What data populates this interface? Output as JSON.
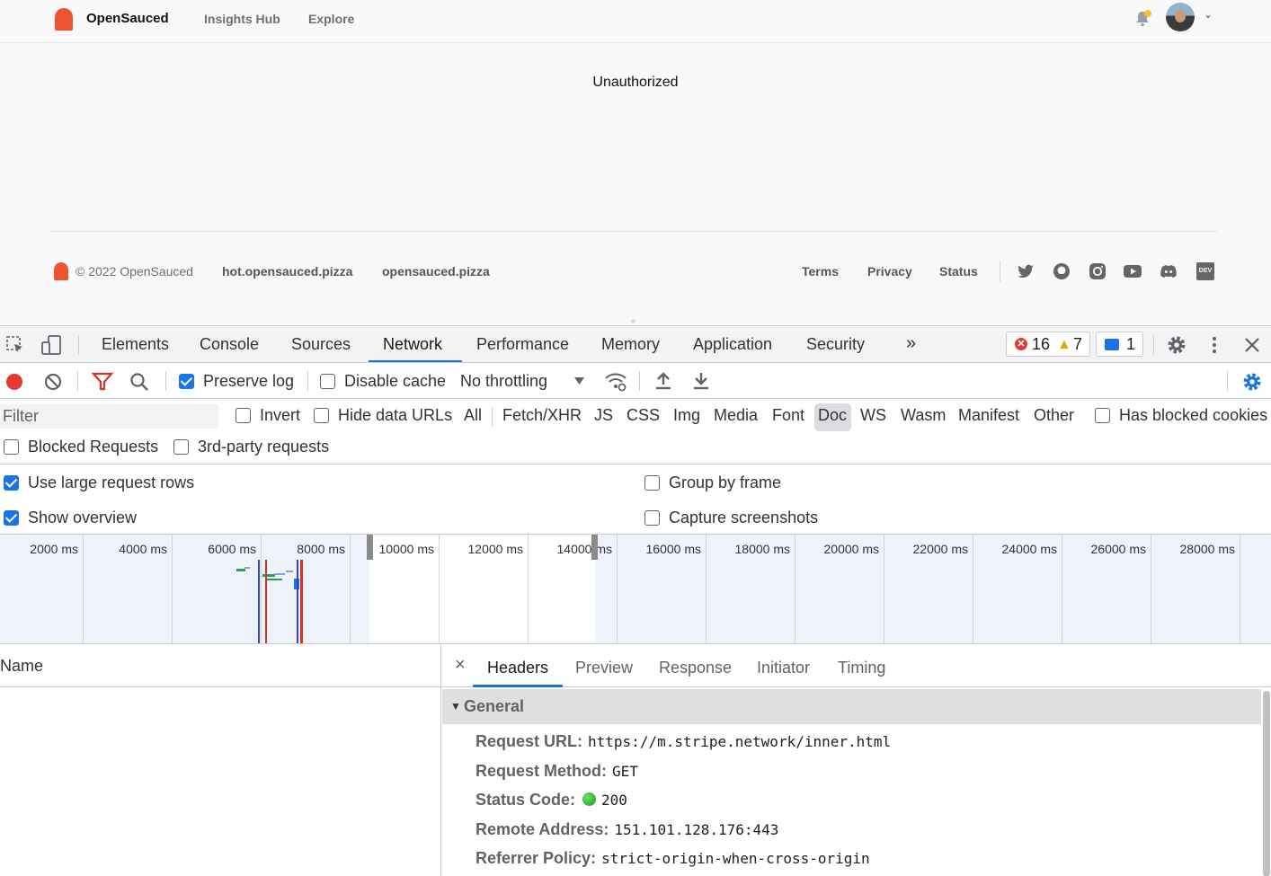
{
  "site": {
    "brand": "OpenSauced",
    "nav": [
      "Insights Hub",
      "Explore"
    ],
    "message": "Unauthorized",
    "footer": {
      "copyright": "© 2022 OpenSauced",
      "links_left": [
        "hot.opensauced.pizza",
        "opensauced.pizza"
      ],
      "links_right": [
        "Terms",
        "Privacy",
        "Status"
      ],
      "social_icons": [
        "twitter-icon",
        "github-icon",
        "instagram-icon",
        "youtube-icon",
        "discord-icon",
        "dev-icon"
      ],
      "dev_badge": "DEV"
    },
    "brand_color": "#ed5432"
  },
  "devtools": {
    "tabs": [
      "Elements",
      "Console",
      "Sources",
      "Network",
      "Performance",
      "Memory",
      "Application",
      "Security"
    ],
    "active_tab": "Network",
    "more_tabs": "»",
    "errors": "16",
    "warnings": "7",
    "messages": "1",
    "toolbar": {
      "preserve_log": "Preserve log",
      "preserve_log_checked": true,
      "disable_cache": "Disable cache",
      "disable_cache_checked": false,
      "throttling": "No throttling"
    },
    "filter": {
      "placeholder": "Filter",
      "invert": "Invert",
      "hide_data_urls": "Hide data URLs",
      "types": [
        "All",
        "Fetch/XHR",
        "JS",
        "CSS",
        "Img",
        "Media",
        "Font",
        "Doc",
        "WS",
        "Wasm",
        "Manifest",
        "Other"
      ],
      "active_type": "Doc",
      "has_blocked_cookies": "Has blocked cookies",
      "blocked_requests": "Blocked Requests",
      "third_party": "3rd-party requests"
    },
    "settings": {
      "large_rows": "Use large request rows",
      "large_rows_checked": true,
      "group_by_frame": "Group by frame",
      "group_by_frame_checked": false,
      "show_overview": "Show overview",
      "show_overview_checked": true,
      "capture_screenshots": "Capture screenshots",
      "capture_screenshots_checked": false
    },
    "overview_ticks": [
      "2000 ms",
      "4000 ms",
      "6000 ms",
      "8000 ms",
      "10000 ms",
      "12000 ms",
      "14000 ms",
      "16000 ms",
      "18000 ms",
      "20000 ms",
      "22000 ms",
      "24000 ms",
      "26000 ms",
      "28000 ms"
    ],
    "name_column": "Name",
    "detail": {
      "close": "×",
      "tabs": [
        "Headers",
        "Preview",
        "Response",
        "Initiator",
        "Timing"
      ],
      "active_tab": "Headers",
      "section": "General",
      "rows": [
        {
          "key": "Request URL:",
          "value": "https://m.stripe.network/inner.html"
        },
        {
          "key": "Request Method:",
          "value": "GET"
        },
        {
          "key": "Status Code:",
          "value": "200"
        },
        {
          "key": "Remote Address:",
          "value": "151.101.128.176:443"
        },
        {
          "key": "Referrer Policy:",
          "value": "strict-origin-when-cross-origin"
        }
      ]
    },
    "accent_color": "#1a73e8",
    "record_color": "#e53935"
  }
}
